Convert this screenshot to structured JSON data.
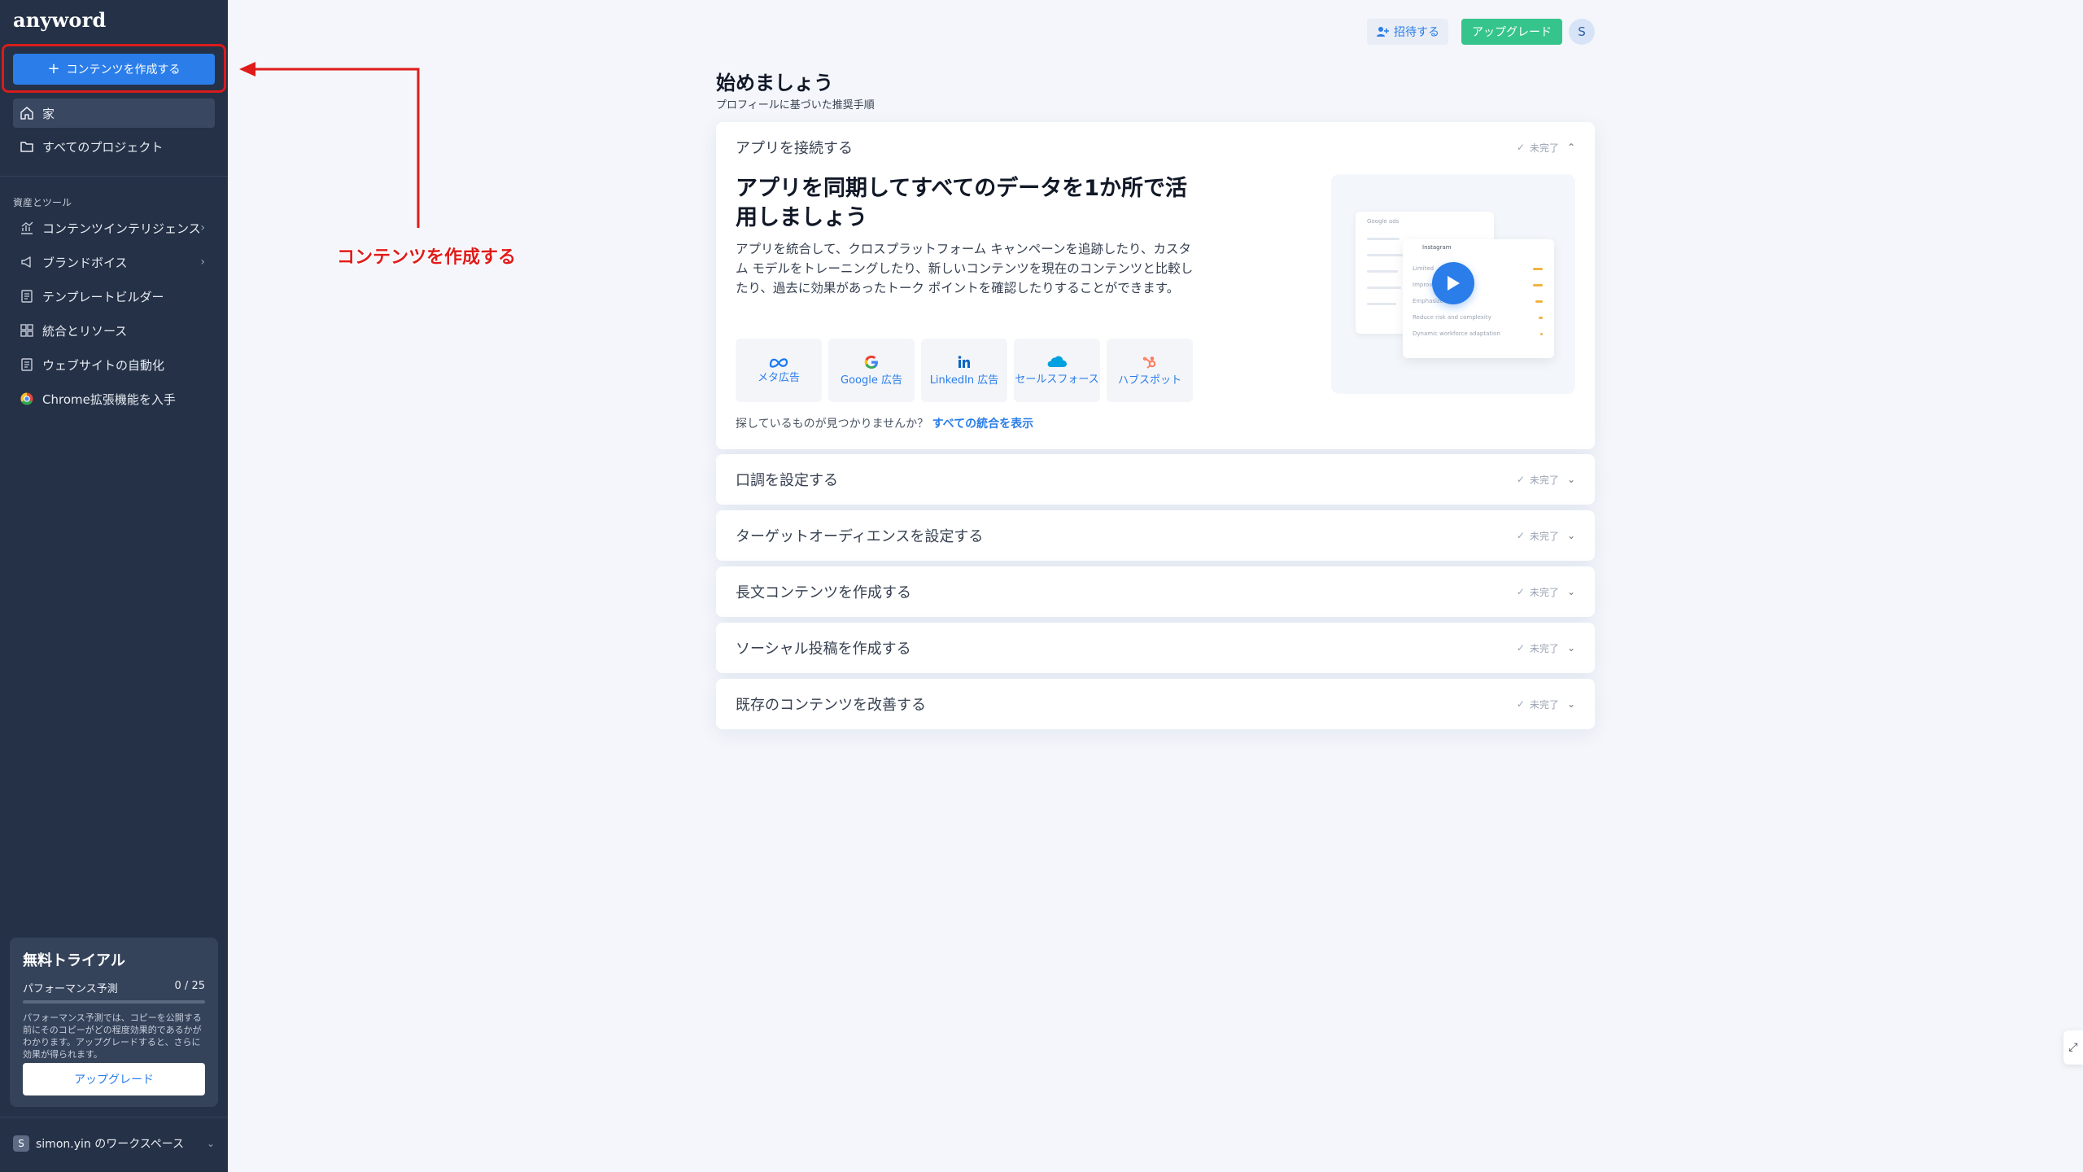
{
  "sidebar": {
    "logo": "anyword",
    "create_button": "コンテンツを作成する",
    "nav": [
      {
        "label": "家",
        "icon": "home-icon",
        "active": true
      },
      {
        "label": "すべてのプロジェクト",
        "icon": "folder-icon",
        "active": false
      }
    ],
    "section_label": "資産とツール",
    "tools": [
      {
        "label": "コンテンツインテリジェンス",
        "icon": "chart-icon",
        "has_submenu": true
      },
      {
        "label": "ブランドボイス",
        "icon": "megaphone-icon",
        "has_submenu": true
      },
      {
        "label": "テンプレートビルダー",
        "icon": "document-icon",
        "has_submenu": false
      },
      {
        "label": "統合とリソース",
        "icon": "grid-icon",
        "has_submenu": false
      },
      {
        "label": "ウェブサイトの自動化",
        "icon": "document-icon",
        "has_submenu": false
      },
      {
        "label": "Chrome拡張機能を入手",
        "icon": "chrome-icon",
        "has_submenu": false
      }
    ],
    "trial": {
      "title": "無料トライアル",
      "metric_label": "パフォーマンス予測",
      "metric_value": "0 / 25",
      "progress_fraction": 0,
      "description": "パフォーマンス予測では、コピーを公開する前にそのコピーがどの程度効果的であるかがわかります。アップグレードすると、さらに効果が得られます。",
      "upgrade_label": "アップグレード"
    },
    "workspace": {
      "avatar_letter": "S",
      "label": "simon.yin のワークスペース"
    }
  },
  "annotation": {
    "label": "コンテンツを作成する",
    "color": "#e01b1b"
  },
  "topbar": {
    "invite_label": "招待する",
    "upgrade_label": "アップグレード",
    "avatar_letter": "S"
  },
  "main": {
    "title": "始めましょう",
    "subtitle": "プロフィールに基づいた推奨手順",
    "status_label": "未完了",
    "steps": [
      {
        "title": "アプリを接続する",
        "expanded": true,
        "heading": "アプリを同期してすべてのデータを1か所で活用しましょう",
        "description": "アプリを統合して、クロスプラットフォーム キャンペーンを追跡したり、カスタム モデルをトレーニングしたり、新しいコンテンツを現在のコンテンツと比較したり、過去に効果があったトーク ポイントを確認したりすることができます。",
        "integrations": [
          {
            "label": "メタ広告",
            "icon": "meta-icon"
          },
          {
            "label": "Google 広告",
            "icon": "google-icon"
          },
          {
            "label": "LinkedIn 広告",
            "icon": "linkedin-icon"
          },
          {
            "label": "セールスフォース",
            "icon": "salesforce-icon"
          },
          {
            "label": "ハブスポット",
            "icon": "hubspot-icon"
          }
        ],
        "help_text": "探しているものが見つかりませんか？",
        "help_link": "すべての統合を表示",
        "video_mock": {
          "card1_title": "Google ads",
          "card2_title": "Instagram",
          "card2_rows": [
            "Limited",
            "Improve",
            "Emphasize",
            "Reduce risk and complexity",
            "Dynamic workforce adaptation"
          ]
        }
      },
      {
        "title": "口調を設定する",
        "expanded": false
      },
      {
        "title": "ターゲットオーディエンスを設定する",
        "expanded": false
      },
      {
        "title": "長文コンテンツを作成する",
        "expanded": false
      },
      {
        "title": "ソーシャル投稿を作成する",
        "expanded": false
      },
      {
        "title": "既存のコンテンツを改善する",
        "expanded": false
      }
    ]
  },
  "colors": {
    "sidebar_bg": "#243146",
    "accent": "#2b7de9",
    "upgrade_green": "#35c58c",
    "page_bg": "#f4f6fb"
  }
}
